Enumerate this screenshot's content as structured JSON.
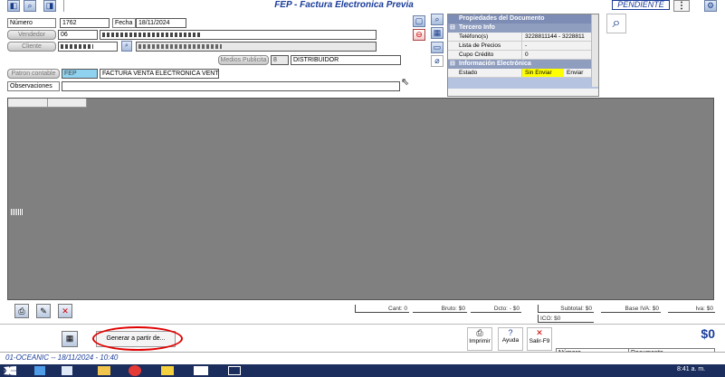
{
  "window": {
    "title": "FEP - Factura Electronica Previa",
    "status": "PENDIENTE",
    "menu_glyph": "⋮"
  },
  "header": {
    "numero_label": "Número",
    "numero_value": "1762",
    "fecha_label": "Fecha",
    "fecha_value": "18/11/2024",
    "vendedor_label": "Vendedor",
    "vendedor_code": "06",
    "vendedor_name": "",
    "cliente_label": "Cliente",
    "cliente_code": "",
    "cliente_name": "",
    "medios_label": "Medios Publicita",
    "medios_code": "8",
    "medios_value": "DISTRIBUIDOR",
    "patron_label": "Patron contable",
    "patron_code": "FEP",
    "patron_value": "FACTURA VENTA ELECTRONICA VENTA",
    "obs_label": "Observaciones"
  },
  "properties": {
    "title": "Propiedades del Documento",
    "section_tercero": "Tercero Info",
    "rows_tercero": [
      {
        "k": "Teléfono(s)",
        "v": "3228811144 - 3228811"
      },
      {
        "k": "Lista de Precios",
        "v": "-"
      },
      {
        "k": "Cupo Crédito",
        "v": "0"
      }
    ],
    "section_fe": "Información Electrónica",
    "estado_label": "Estado",
    "estado_value": "Sin Enviar",
    "estado_action": "Enviar"
  },
  "totals": {
    "cant": "Cant: 0",
    "bruto": "Bruto: $0",
    "dcto": "Dcto: - $0",
    "subtotal": "Subtotal: $0",
    "base_iva": "Base IVA: $0",
    "iva": "Iva: $0",
    "ico": "ICO: $0",
    "total": "$0"
  },
  "actions": {
    "generar": "Generar a partir de...",
    "imprimir": "Imprimir",
    "ayuda": "Ayuda",
    "salir": "Salir-F9",
    "numero_label": "Número",
    "documento_label": "Documento"
  },
  "statusbar": {
    "text": "01-OCEANIC -- 18/11/2024 - 10:40"
  },
  "taskbar": {
    "time": "8:41 a. m."
  },
  "colors": {
    "accent": "#1a3c9a",
    "highlight_yellow": "#ffff00",
    "annotation_red": "#e00000"
  }
}
